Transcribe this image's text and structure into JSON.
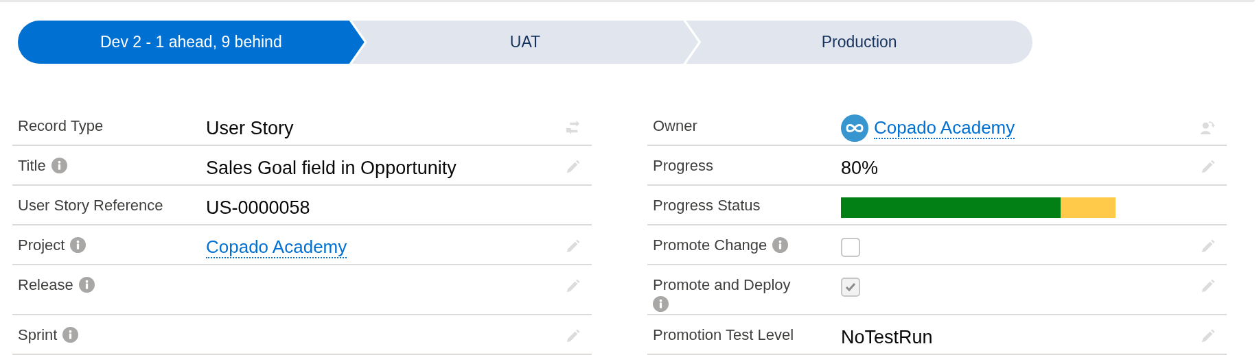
{
  "path": {
    "stages": [
      {
        "label": "Dev 2 - 1 ahead, 9 behind",
        "selected": true
      },
      {
        "label": "UAT",
        "selected": false
      },
      {
        "label": "Production",
        "selected": false
      }
    ]
  },
  "left_fields": [
    {
      "label": "Record Type",
      "info": false,
      "kind": "text",
      "value": "User Story",
      "action": {
        "kind": "swap"
      }
    },
    {
      "label": "Title",
      "info": true,
      "kind": "text",
      "value": "Sales Goal field in Opportunity",
      "action": {
        "kind": "edit"
      }
    },
    {
      "label": "User Story Reference",
      "info": false,
      "kind": "text",
      "value": "US-0000058"
    },
    {
      "label": "Project",
      "info": true,
      "kind": "link",
      "value": "Copado Academy",
      "action": {
        "kind": "edit"
      }
    },
    {
      "label": "Release",
      "info": true,
      "kind": "empty",
      "action": {
        "kind": "edit"
      }
    },
    {
      "label": "Sprint",
      "info": true,
      "kind": "empty",
      "action": {
        "kind": "edit"
      }
    }
  ],
  "right_fields": [
    {
      "label": "Owner",
      "info": false,
      "kind": "owner",
      "value": "Copado Academy",
      "action": {
        "kind": "owner"
      }
    },
    {
      "label": "Progress",
      "info": false,
      "kind": "text",
      "value": "80%",
      "action": {
        "kind": "edit"
      }
    },
    {
      "label": "Progress Status",
      "info": false,
      "kind": "progress",
      "level": 0.8
    },
    {
      "label": "Promote Change",
      "info": true,
      "kind": "checkbox",
      "checked": false,
      "action": {
        "kind": "edit"
      }
    },
    {
      "label": "Promote and Deploy",
      "info": true,
      "kind": "checkbox",
      "checked": true,
      "action": {
        "kind": "edit"
      }
    },
    {
      "label": "Promotion Test Level",
      "info": false,
      "kind": "text",
      "value": "NoTestRun",
      "action": {
        "kind": "edit"
      }
    }
  ]
}
